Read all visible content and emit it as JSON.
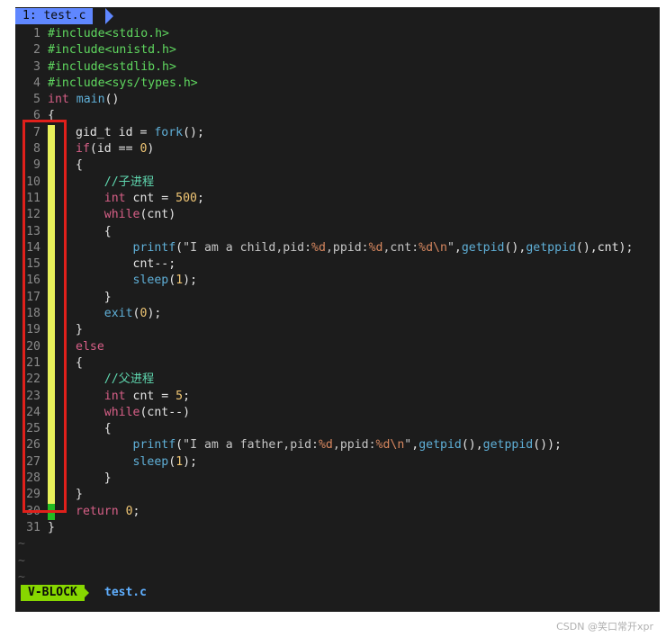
{
  "tab": {
    "label": "1: test.c"
  },
  "lines": [
    {
      "n": "1",
      "parts": [
        [
          "pp",
          "#include<stdio.h>"
        ]
      ]
    },
    {
      "n": "2",
      "parts": [
        [
          "pp",
          "#include<unistd.h>"
        ]
      ]
    },
    {
      "n": "3",
      "parts": [
        [
          "pp",
          "#include<stdlib.h>"
        ]
      ]
    },
    {
      "n": "4",
      "parts": [
        [
          "pp",
          "#include<sys/types.h>"
        ]
      ]
    },
    {
      "n": "5",
      "parts": [
        [
          "ty",
          "int"
        ],
        [
          "",
          " "
        ],
        [
          "fn",
          "main"
        ],
        [
          "",
          "()"
        ]
      ]
    },
    {
      "n": "6",
      "parts": [
        [
          "",
          "{"
        ]
      ]
    },
    {
      "n": "7",
      "parts": [
        [
          "",
          "gid_t id = "
        ],
        [
          "fn",
          "fork"
        ],
        [
          "",
          "();"
        ]
      ]
    },
    {
      "n": "8",
      "parts": [
        [
          "kw",
          "if"
        ],
        [
          "",
          "(id == "
        ],
        [
          "num",
          "0"
        ],
        [
          "",
          ")"
        ]
      ]
    },
    {
      "n": "9",
      "parts": [
        [
          "",
          "{"
        ]
      ]
    },
    {
      "n": "10",
      "parts": [
        [
          "cm",
          "    //子进程"
        ]
      ]
    },
    {
      "n": "11",
      "parts": [
        [
          "",
          "    "
        ],
        [
          "ty",
          "int"
        ],
        [
          "",
          " cnt = "
        ],
        [
          "num",
          "500"
        ],
        [
          "",
          ";"
        ]
      ]
    },
    {
      "n": "12",
      "parts": [
        [
          "",
          "    "
        ],
        [
          "kw",
          "while"
        ],
        [
          "",
          "(cnt)"
        ]
      ]
    },
    {
      "n": "13",
      "parts": [
        [
          "",
          "    {"
        ]
      ]
    },
    {
      "n": "14",
      "parts": [
        [
          "",
          "        "
        ],
        [
          "fn",
          "printf"
        ],
        [
          "",
          "("
        ],
        [
          "str",
          "\"I am a child,pid:"
        ],
        [
          "esc",
          "%d"
        ],
        [
          "str",
          ",ppid:"
        ],
        [
          "esc",
          "%d"
        ],
        [
          "str",
          ",cnt:"
        ],
        [
          "esc",
          "%d\\n"
        ],
        [
          "str",
          "\""
        ],
        [
          "",
          ","
        ],
        [
          "fn",
          "getpid"
        ],
        [
          "",
          "(),"
        ],
        [
          "fn",
          "getppid"
        ],
        [
          "",
          "(),cnt);"
        ]
      ]
    },
    {
      "n": "15",
      "parts": [
        [
          "",
          "        cnt--;"
        ]
      ]
    },
    {
      "n": "16",
      "parts": [
        [
          "",
          "        "
        ],
        [
          "fn",
          "sleep"
        ],
        [
          "",
          "("
        ],
        [
          "num",
          "1"
        ],
        [
          "",
          ");"
        ]
      ]
    },
    {
      "n": "17",
      "parts": [
        [
          "",
          "    }"
        ]
      ]
    },
    {
      "n": "18",
      "parts": [
        [
          "",
          "    "
        ],
        [
          "fn",
          "exit"
        ],
        [
          "",
          "("
        ],
        [
          "num",
          "0"
        ],
        [
          "",
          ");"
        ]
      ]
    },
    {
      "n": "19",
      "parts": [
        [
          "",
          "}"
        ]
      ]
    },
    {
      "n": "20",
      "parts": [
        [
          "kw",
          "else"
        ]
      ]
    },
    {
      "n": "21",
      "parts": [
        [
          "",
          "{"
        ]
      ]
    },
    {
      "n": "22",
      "parts": [
        [
          "cm",
          "    //父进程"
        ]
      ]
    },
    {
      "n": "23",
      "parts": [
        [
          "",
          "    "
        ],
        [
          "ty",
          "int"
        ],
        [
          "",
          " cnt = "
        ],
        [
          "num",
          "5"
        ],
        [
          "",
          ";"
        ]
      ]
    },
    {
      "n": "24",
      "parts": [
        [
          "",
          "    "
        ],
        [
          "kw",
          "while"
        ],
        [
          "",
          "(cnt--)"
        ]
      ]
    },
    {
      "n": "25",
      "parts": [
        [
          "",
          "    {"
        ]
      ]
    },
    {
      "n": "26",
      "parts": [
        [
          "",
          "        "
        ],
        [
          "fn",
          "printf"
        ],
        [
          "",
          "("
        ],
        [
          "str",
          "\"I am a father,pid:"
        ],
        [
          "esc",
          "%d"
        ],
        [
          "str",
          ",ppid:"
        ],
        [
          "esc",
          "%d\\n"
        ],
        [
          "str",
          "\""
        ],
        [
          "",
          ","
        ],
        [
          "fn",
          "getpid"
        ],
        [
          "",
          "(),"
        ],
        [
          "fn",
          "getppid"
        ],
        [
          "",
          "());"
        ]
      ]
    },
    {
      "n": "27",
      "parts": [
        [
          "",
          "        "
        ],
        [
          "fn",
          "sleep"
        ],
        [
          "",
          "("
        ],
        [
          "num",
          "1"
        ],
        [
          "",
          ");"
        ]
      ]
    },
    {
      "n": "28",
      "parts": [
        [
          "",
          "    }"
        ]
      ]
    },
    {
      "n": "29",
      "parts": [
        [
          "",
          "}"
        ]
      ]
    },
    {
      "n": "30",
      "parts": [
        [
          "kw",
          "return"
        ],
        [
          "",
          " "
        ],
        [
          "num",
          "0"
        ],
        [
          "",
          ";"
        ]
      ]
    },
    {
      "n": "31",
      "parts": [
        [
          "",
          "}"
        ]
      ]
    }
  ],
  "tilde": "~",
  "status": {
    "mode": "V-BLOCK",
    "filename": "test.c"
  },
  "watermark": "CSDN @笑口常开xpr",
  "colors": {
    "tab_bg": "#5f87ff",
    "mode_bg": "#87d700",
    "vblock_selection": "#e8f05a",
    "cursor": "#22bb22",
    "highlight_box": "#e0201b"
  }
}
